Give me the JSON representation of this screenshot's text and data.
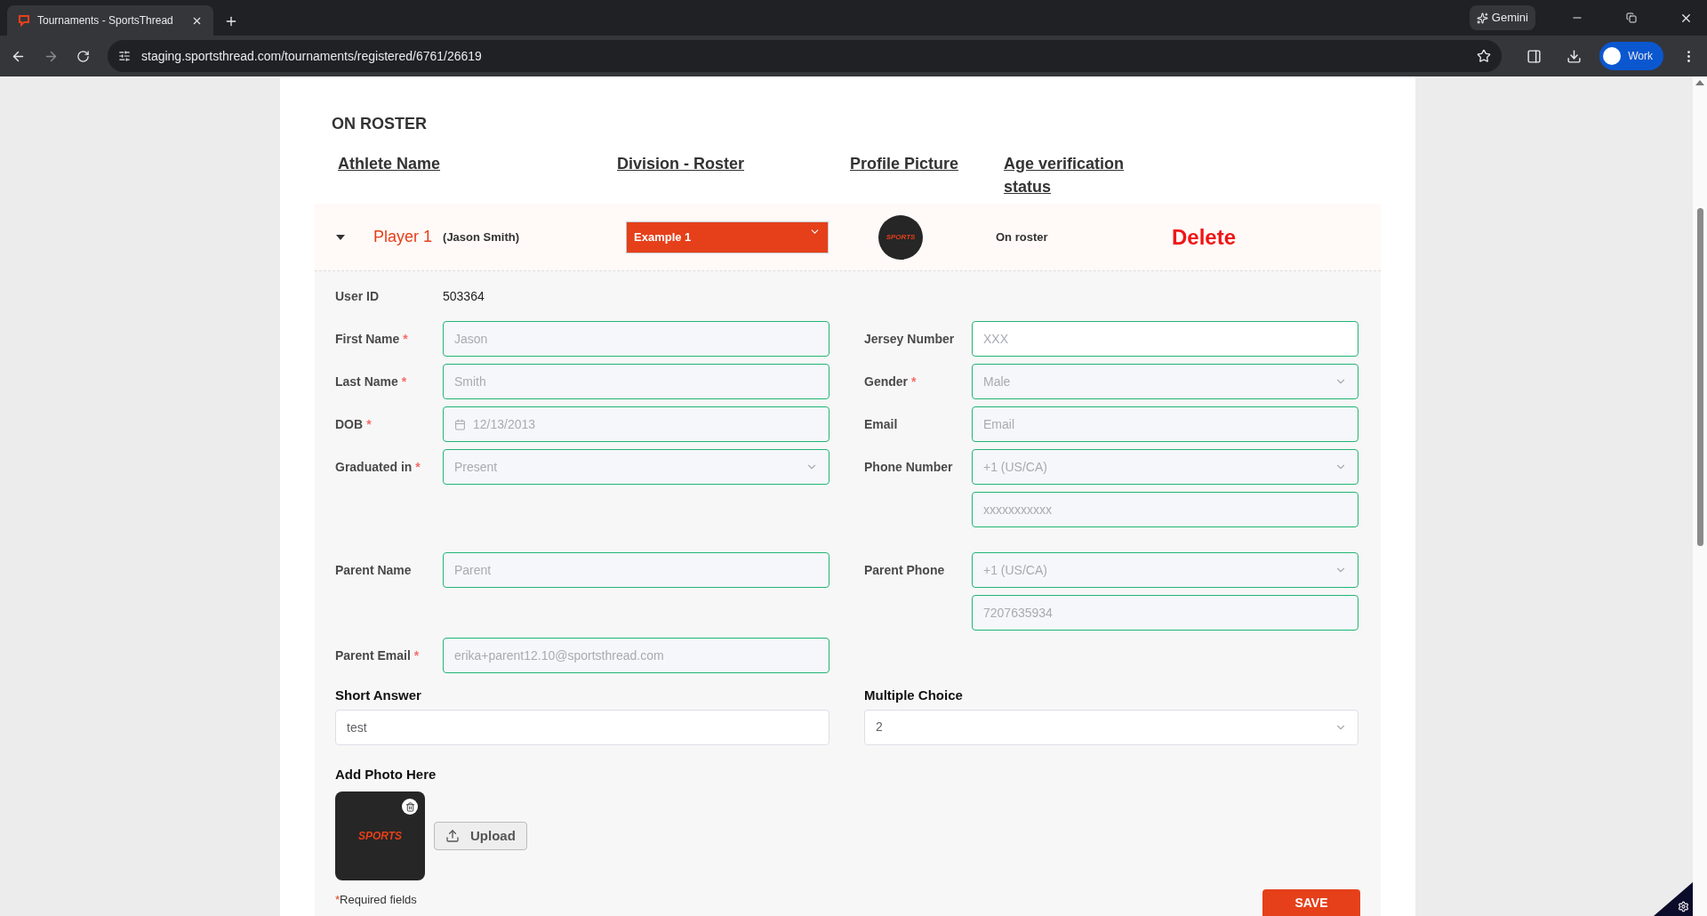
{
  "browser": {
    "tab_title": "Tournaments - SportsThread",
    "ai_button": "Gemini",
    "url": "staging.sportsthread.com/tournaments/registered/6761/26619",
    "profile": "Work"
  },
  "section_title": "ON ROSTER",
  "columns": [
    "Athlete Name",
    "Division - Roster",
    "Profile Picture",
    "Age verification status"
  ],
  "athlete": {
    "expanded": true,
    "name": "Player 1",
    "full_name": "(Jason Smith)",
    "division": "Example 1",
    "avatar_logo": "SPORTS",
    "status": "On roster",
    "delete": "Delete"
  },
  "form": {
    "required_mark": "*",
    "sections": [
      {
        "rows": [
          {
            "left": {
              "kind": "static",
              "label": "User ID",
              "value": "503364"
            },
            "right": null
          },
          {
            "left": {
              "kind": "input",
              "label": "First Name",
              "required": true,
              "disabled": true,
              "value": "Jason"
            },
            "right": {
              "kind": "input",
              "label": "Jersey Number",
              "required": false,
              "disabled": false,
              "placeholder": "XXX"
            }
          },
          {
            "left": {
              "kind": "input",
              "label": "Last Name",
              "required": true,
              "disabled": true,
              "value": "Smith"
            },
            "right": {
              "kind": "select",
              "label": "Gender",
              "required": true,
              "disabled": true,
              "value": "Male"
            }
          },
          {
            "left": {
              "kind": "date",
              "label": "DOB",
              "required": true,
              "disabled": true,
              "value": "12/13/2013"
            },
            "right": {
              "kind": "input",
              "label": "Email",
              "required": false,
              "disabled": true,
              "placeholder": "Email"
            }
          },
          {
            "left": {
              "kind": "select",
              "label": "Graduated in",
              "required": true,
              "disabled": true,
              "value": "Present"
            },
            "right": {
              "kind": "select",
              "label": "Phone Number",
              "required": false,
              "disabled": true,
              "value": "+1 (US/CA)"
            }
          },
          {
            "left": null,
            "right": {
              "kind": "input",
              "disabled": true,
              "placeholder": "xxxxxxxxxxx"
            }
          }
        ]
      },
      {
        "rows": [
          {
            "left": {
              "kind": "input",
              "label": "Parent Name",
              "required": false,
              "disabled": true,
              "placeholder": "Parent"
            },
            "right": {
              "kind": "select",
              "label": "Parent Phone",
              "required": false,
              "disabled": true,
              "value": "+1 (US/CA)"
            }
          },
          {
            "left": null,
            "right": {
              "kind": "input",
              "disabled": true,
              "value": "7207635934"
            }
          },
          {
            "left": {
              "kind": "input",
              "label": "Parent Email",
              "required": true,
              "disabled": true,
              "value": "erika+parent12.10@sportsthread.com"
            },
            "right": null
          }
        ]
      }
    ]
  },
  "questions": [
    {
      "label": "Short Answer",
      "kind": "input",
      "value": "test"
    },
    {
      "label": "Multiple Choice",
      "kind": "select",
      "value": "2"
    }
  ],
  "photo": {
    "label": "Add Photo Here",
    "logo": "SPORTS",
    "upload": "Upload"
  },
  "required_note": {
    "mark": "*",
    "text": "Required fields"
  },
  "save": "SAVE"
}
